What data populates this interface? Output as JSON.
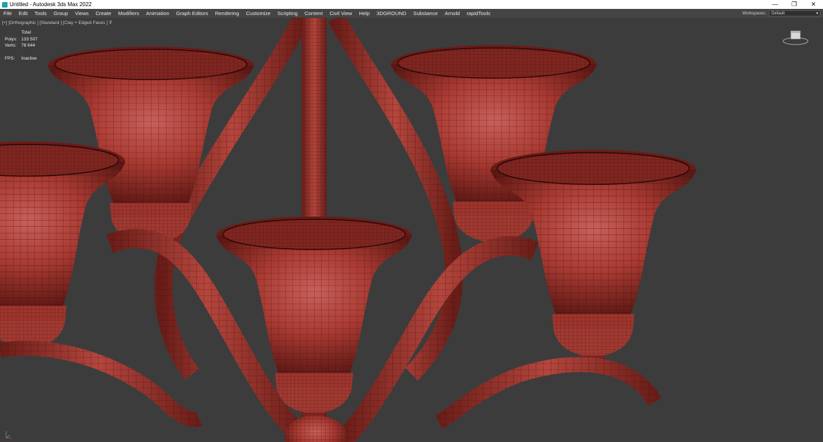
{
  "window": {
    "title": "Untitled - Autodesk 3ds Max 2022",
    "controls": [
      "—",
      "❐",
      "✕"
    ]
  },
  "menu": [
    "File",
    "Edit",
    "Tools",
    "Group",
    "Views",
    "Create",
    "Modifiers",
    "Animation",
    "Graph Editors",
    "Rendering",
    "Customize",
    "Scripting",
    "Content",
    "Civil View",
    "Help",
    "3DGROUND",
    "Substance",
    "Arnold",
    "rapidTools"
  ],
  "workspaces": {
    "label": "Workspaces:",
    "value": "Default"
  },
  "viewport": {
    "label": "[+] [Orthographic ] [Standard ] [Clay + Edged Faces ]",
    "filter_icon": "filter-icon",
    "stats": {
      "header": "Total",
      "polys_label": "Polys:",
      "polys_value": "133 507",
      "verts_label": "Verts:",
      "verts_value": "78 844",
      "fps_label": "FPS:",
      "fps_value": "Inactive"
    }
  },
  "colors": {
    "clay": "#a83a32",
    "clay_dark": "#5e1814",
    "wire": "#3a0d0a",
    "viewport_bg": "#3c3c3c",
    "menubar": "#444444"
  }
}
